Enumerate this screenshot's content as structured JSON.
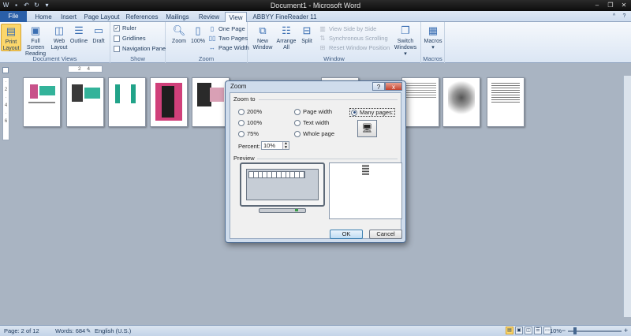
{
  "window": {
    "title": "Document1 - Microsoft Word",
    "qat_icons": [
      "word-logo-icon",
      "save-icon",
      "undo-icon",
      "redo-icon",
      "customize-qat-icon"
    ]
  },
  "tabs": [
    "File",
    "Home",
    "Insert",
    "Page Layout",
    "References",
    "Mailings",
    "Review",
    "View",
    "ABBYY FineReader 11"
  ],
  "active_tab": "View",
  "ribbon": {
    "document_views": {
      "label": "Document Views",
      "print_layout": "Print\nLayout",
      "full_screen": "Full Screen\nReading",
      "web_layout": "Web\nLayout",
      "outline": "Outline",
      "draft": "Draft"
    },
    "show": {
      "label": "Show",
      "ruler": "Ruler",
      "gridlines": "Gridlines",
      "navigation_pane": "Navigation Pane",
      "ruler_checked": "✓"
    },
    "zoom": {
      "label": "Zoom",
      "zoom": "Zoom",
      "hundred": "100%",
      "one_page": "One Page",
      "two_pages": "Two Pages",
      "page_width": "Page Width"
    },
    "window": {
      "label": "Window",
      "new_window": "New\nWindow",
      "arrange_all": "Arrange\nAll",
      "split": "Split",
      "view_side_by_side": "View Side by Side",
      "sync_scrolling": "Synchronous Scrolling",
      "reset_position": "Reset Window Position",
      "switch_windows": "Switch\nWindows ▾"
    },
    "macros": {
      "label": "Macros",
      "macros": "Macros\n▾"
    }
  },
  "ruler": {
    "marks": "2 4"
  },
  "dialog": {
    "title": "Zoom",
    "help": "?",
    "close": "x",
    "zoom_to_label": "Zoom to",
    "options": {
      "p200": "200%",
      "p100": "100%",
      "p75": "75%",
      "page_width": "Page width",
      "text_width": "Text width",
      "whole_page": "Whole page",
      "many_pages": "Many pages:"
    },
    "selected_option": "many_pages",
    "percent_label": "Percent:",
    "percent_value": "10%",
    "preview_label": "Preview",
    "ok": "OK",
    "cancel": "Cancel"
  },
  "status": {
    "page": "Page: 2 of 12",
    "words": "Words: 684",
    "language": "English (U.S.)",
    "zoom": "10%"
  }
}
